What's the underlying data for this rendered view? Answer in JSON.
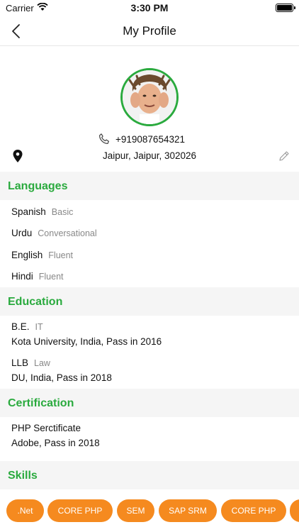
{
  "status": {
    "carrier": "Carrier",
    "time": "3:30 PM"
  },
  "nav": {
    "title": "My Profile"
  },
  "profile": {
    "phone": "+919087654321",
    "address": "Jaipur, Jaipur, 302026"
  },
  "languages": {
    "header": "Languages",
    "items": [
      {
        "name": "Spanish",
        "level": "Basic"
      },
      {
        "name": "Urdu",
        "level": "Conversational"
      },
      {
        "name": "English",
        "level": "Fluent"
      },
      {
        "name": "Hindi",
        "level": "Fluent"
      }
    ]
  },
  "education": {
    "header": "Education",
    "items": [
      {
        "degree": "B.E.",
        "field": "IT",
        "details": "Kota University, India, Pass in 2016"
      },
      {
        "degree": "LLB",
        "field": "Law",
        "details": "DU, India, Pass in 2018"
      }
    ]
  },
  "certification": {
    "header": "Certification",
    "items": [
      {
        "title": "PHP Serctificate",
        "details": "Adobe, Pass in 2018"
      }
    ]
  },
  "skills": {
    "header": "Skills",
    "items": [
      ".Net",
      "CORE PHP",
      "SEM",
      "SAP SRM",
      "CORE PHP"
    ]
  },
  "colors": {
    "accent": "#2aaa3e",
    "chip": "#f58a1f",
    "section_bg": "#f5f5f5"
  }
}
